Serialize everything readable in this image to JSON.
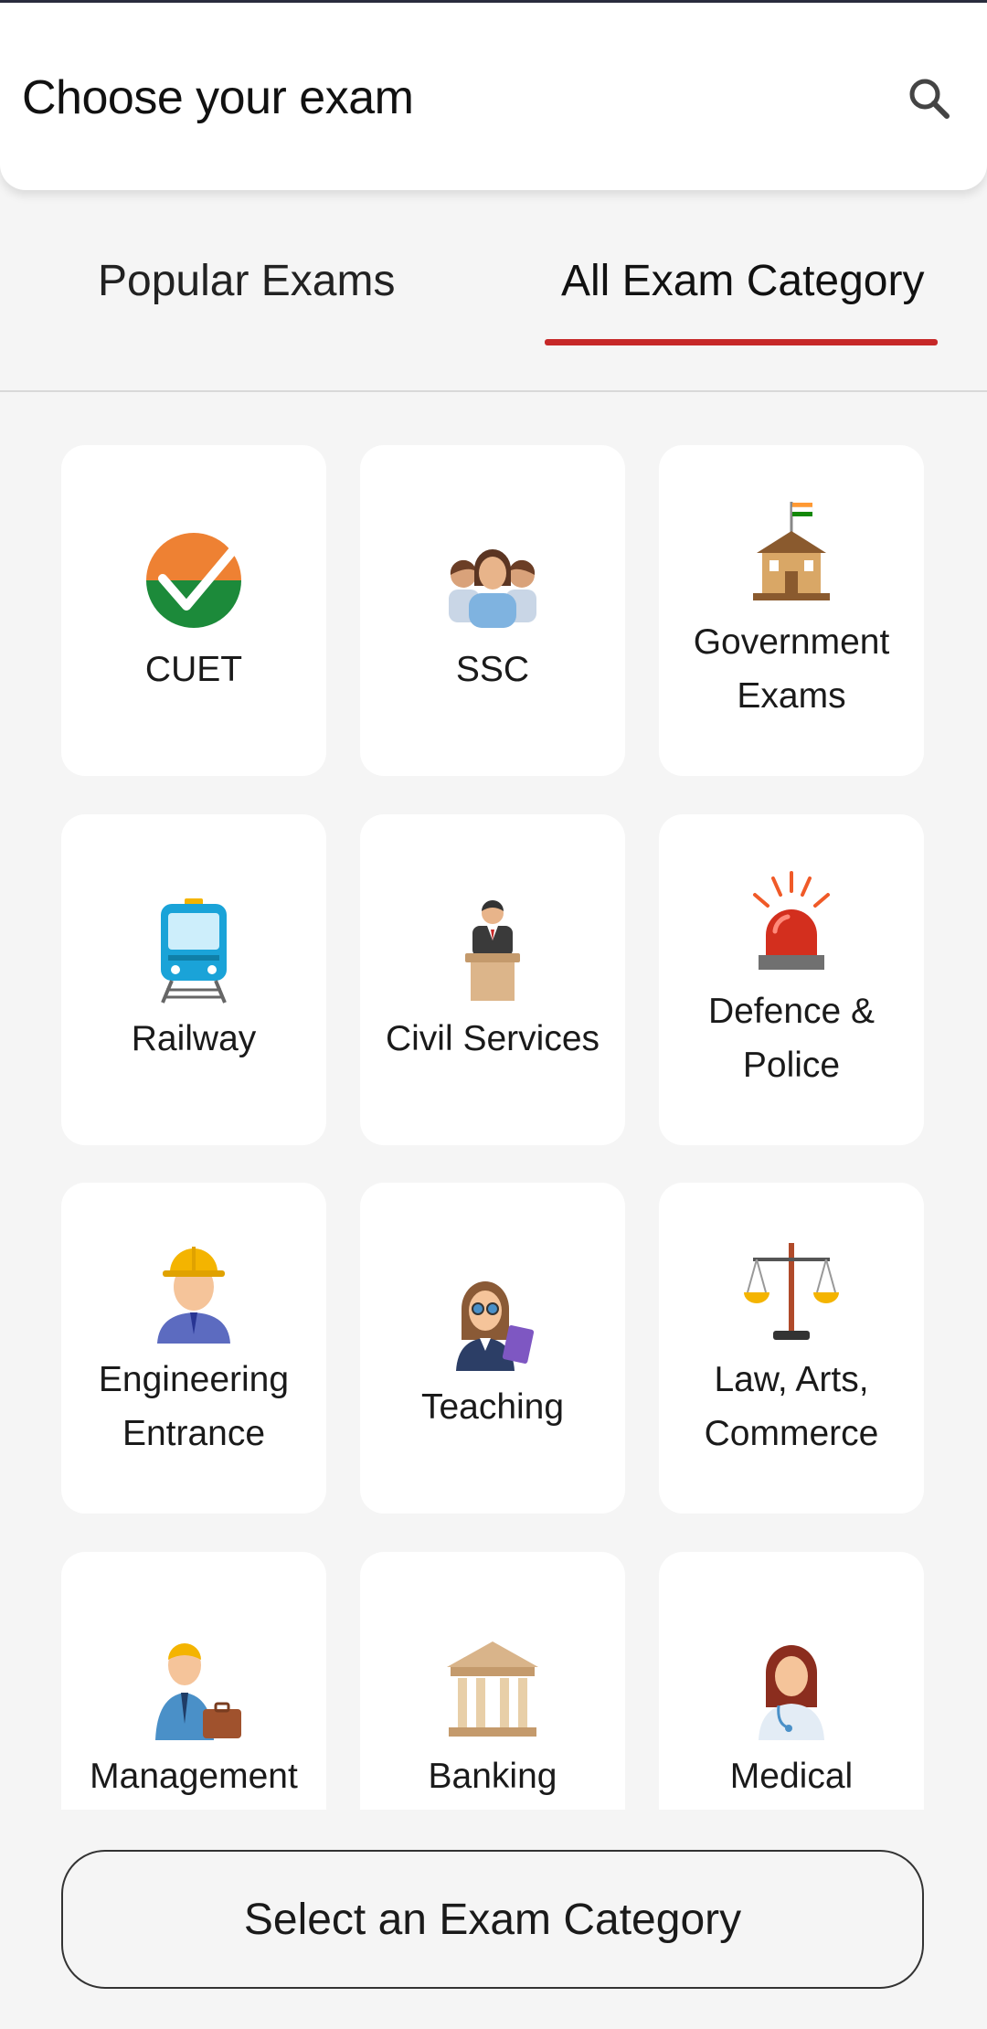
{
  "header": {
    "title": "Choose your exam",
    "search_icon": "search-icon"
  },
  "tabs": [
    {
      "label": "Popular Exams",
      "active": false
    },
    {
      "label": "All Exam Category",
      "active": true
    }
  ],
  "colors": {
    "accent": "#c62828",
    "card_bg": "#ffffff",
    "page_bg": "#f5f5f5"
  },
  "categories": [
    {
      "label": "CUET",
      "icon": "checkmark-badge-icon"
    },
    {
      "label": "SSC",
      "icon": "people-group-icon"
    },
    {
      "label": "Government Exams",
      "icon": "government-building-icon"
    },
    {
      "label": "Railway",
      "icon": "train-icon"
    },
    {
      "label": "Civil Services",
      "icon": "speaker-podium-icon"
    },
    {
      "label": "Defence & Police",
      "icon": "siren-icon"
    },
    {
      "label": "Engineering Entrance",
      "icon": "engineer-icon"
    },
    {
      "label": "Teaching",
      "icon": "teacher-icon"
    },
    {
      "label": "Law, Arts, Commerce",
      "icon": "scales-of-justice-icon"
    },
    {
      "label": "Management",
      "icon": "businessman-icon"
    },
    {
      "label": "Banking",
      "icon": "bank-icon"
    },
    {
      "label": "Medical",
      "icon": "doctor-icon"
    }
  ],
  "footer": {
    "button_label": "Select an Exam Category"
  }
}
